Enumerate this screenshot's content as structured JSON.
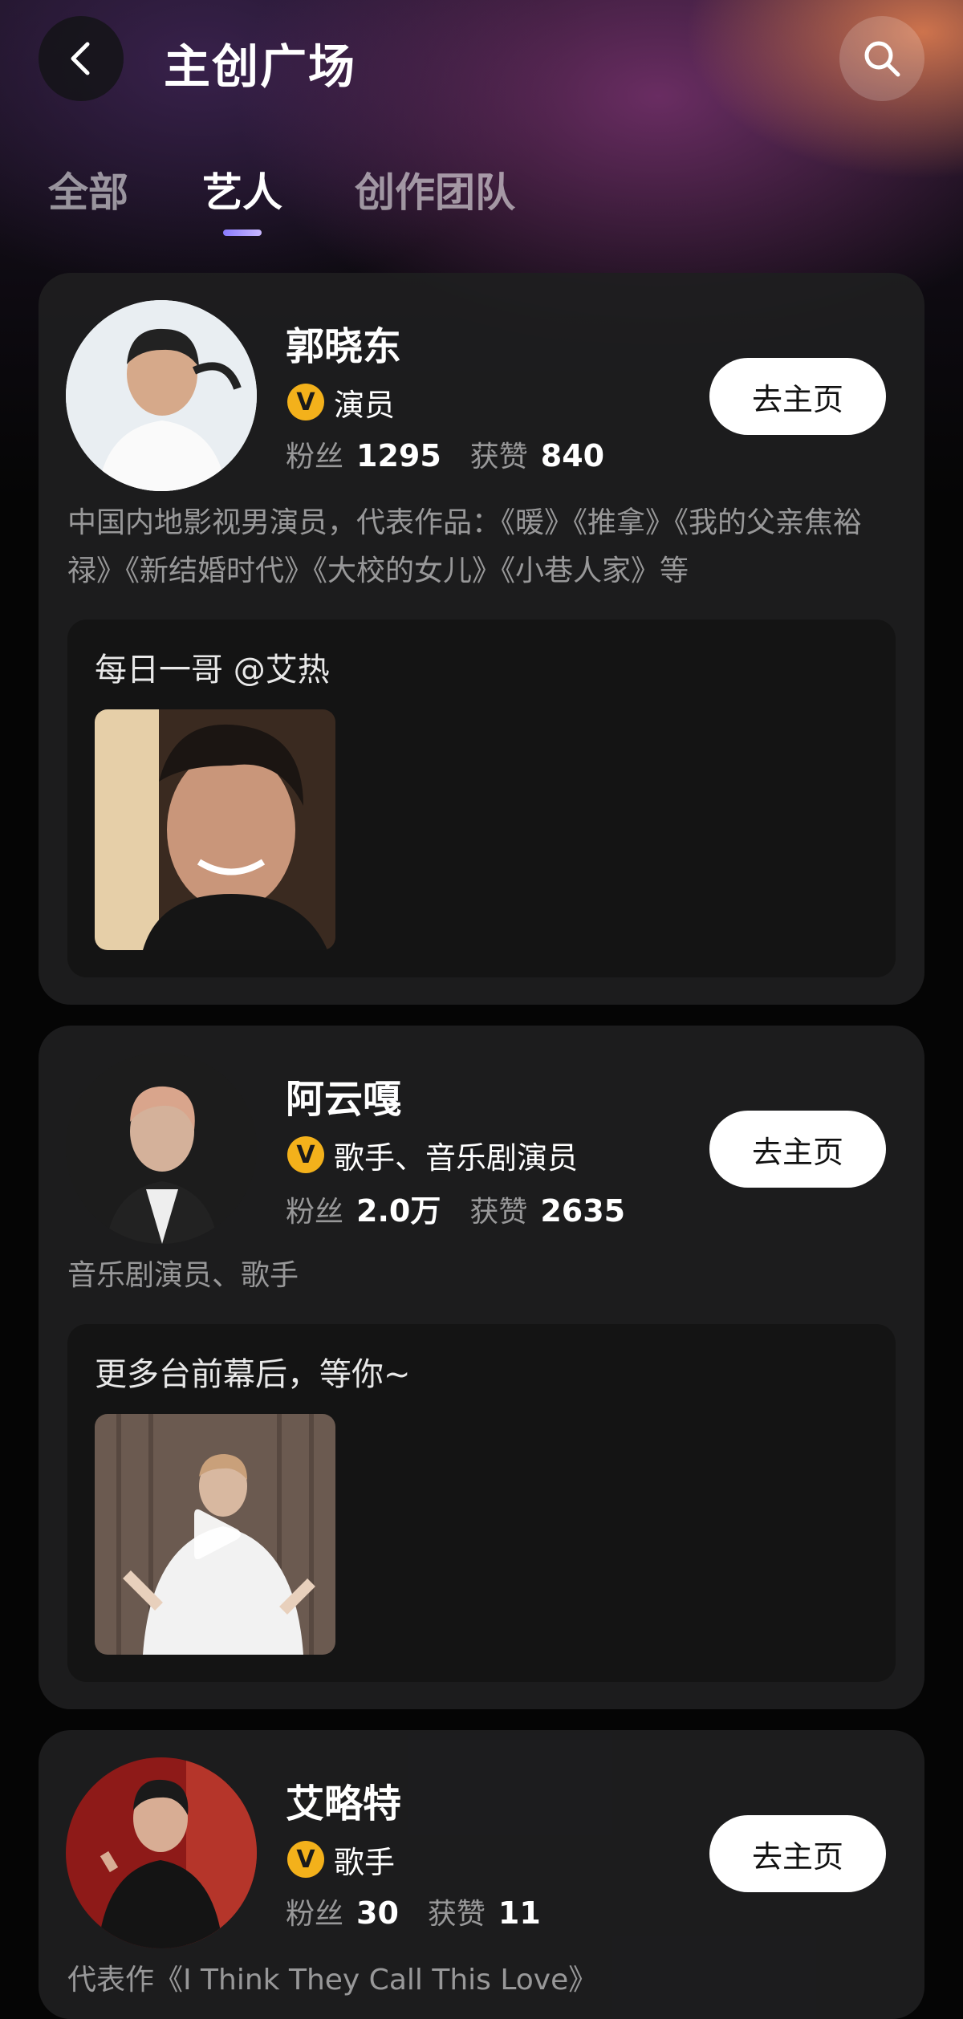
{
  "header": {
    "title": "主创广场"
  },
  "tabs": [
    {
      "label": "全部",
      "active": false
    },
    {
      "label": "艺人",
      "active": true
    },
    {
      "label": "创作团队",
      "active": false
    }
  ],
  "artists": [
    {
      "name": "郭晓东",
      "badge": "V",
      "role": "演员",
      "fans_label": "粉丝",
      "fans": "1295",
      "likes_label": "获赞",
      "likes": "840",
      "action": "去主页",
      "description": "中国内地影视男演员，代表作品：《暖》《推拿》《我的父亲焦裕禄》《新结婚时代》《大校的女儿》《小巷人家》等",
      "post_text": "每日一哥 @艾热"
    },
    {
      "name": "阿云嘎",
      "badge": "V",
      "role": "歌手、音乐剧演员",
      "fans_label": "粉丝",
      "fans": "2.0万",
      "likes_label": "获赞",
      "likes": "2635",
      "action": "去主页",
      "description": "音乐剧演员、歌手",
      "post_text": "更多台前幕后，等你~"
    },
    {
      "name": "艾略特",
      "badge": "V",
      "role": "歌手",
      "fans_label": "粉丝",
      "fans": "30",
      "likes_label": "获赞",
      "likes": "11",
      "action": "去主页",
      "description": "代表作《I Think They Call This Love》"
    }
  ],
  "colors": {
    "badge": "#f3b11b",
    "tab_indicator": "#8a7cff",
    "card_bg": "#1e1e20",
    "post_bg": "#141414"
  }
}
